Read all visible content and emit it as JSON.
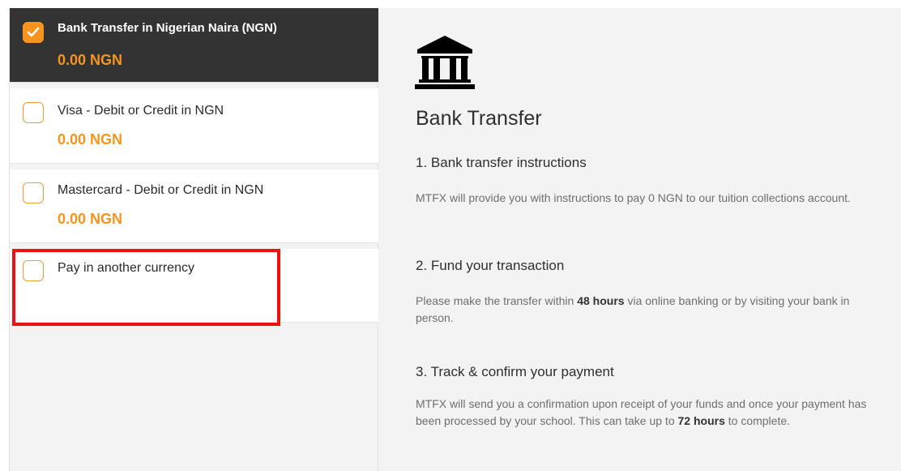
{
  "options": [
    {
      "label": "Bank Transfer in Nigerian Naira (NGN)",
      "amount": "0.00 NGN",
      "selected": true
    },
    {
      "label": "Visa - Debit or Credit in NGN",
      "amount": "0.00 NGN",
      "selected": false
    },
    {
      "label": "Mastercard - Debit or Credit in NGN",
      "amount": "0.00 NGN",
      "selected": false
    },
    {
      "label": "Pay in another currency",
      "selected": false
    }
  ],
  "detail": {
    "icon": "bank-icon",
    "title": "Bank Transfer",
    "steps": [
      {
        "title": "1. Bank transfer instructions",
        "text": "MTFX will provide you with instructions to pay 0 NGN to our tuition collections account."
      },
      {
        "title": "2. Fund your transaction",
        "text_before": "Please make the transfer within ",
        "text_bold": "48 hours",
        "text_after": " via online banking or by visiting your bank in person."
      },
      {
        "title": "3. Track & confirm your payment",
        "text_before": "MTFX will send you a confirmation upon receipt of your funds and once your payment has been processed by your school. This can take up to ",
        "text_bold": "72 hours",
        "text_after": " to complete."
      }
    ]
  },
  "colors": {
    "accent_orange": "#f7941d",
    "selected_bg": "#333333",
    "highlight_red": "#ee1111",
    "panel_bg": "#f3f3f3"
  }
}
